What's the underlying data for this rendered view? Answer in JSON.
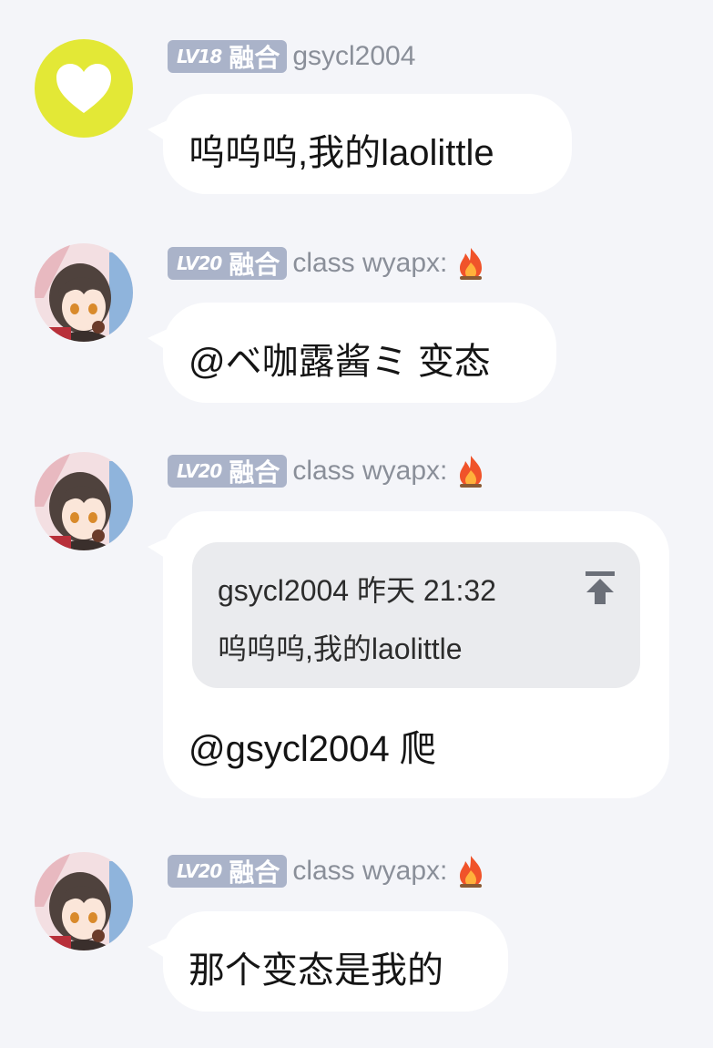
{
  "messages": [
    {
      "level": "LV18",
      "tag": "融合",
      "username": "gsycl2004",
      "avatar": "yellow-heart-avatar",
      "text": "呜呜呜,我的laolittle"
    },
    {
      "level": "LV20",
      "tag": "融合",
      "username": "class wyapx:",
      "avatar": "anime-girl-avatar",
      "text": "@ベ咖露酱ミ 变态"
    },
    {
      "level": "LV20",
      "tag": "融合",
      "username": "class wyapx:",
      "avatar": "anime-girl-avatar",
      "quote": {
        "header": "gsycl2004 昨天 21:32",
        "body": "呜呜呜,我的laolittle",
        "icon": "jump-to-icon"
      },
      "text": "@gsycl2004 爬"
    },
    {
      "level": "LV20",
      "tag": "融合",
      "username": "class wyapx:",
      "avatar": "anime-girl-avatar",
      "text": "那个变态是我的"
    }
  ],
  "colors": {
    "background": "#f4f5f9",
    "badge": "#aab3c9",
    "avatar_yellow": "#e3e836",
    "bubble": "#ffffff",
    "quote_bg": "#eaebee",
    "username": "#8a8f99"
  }
}
